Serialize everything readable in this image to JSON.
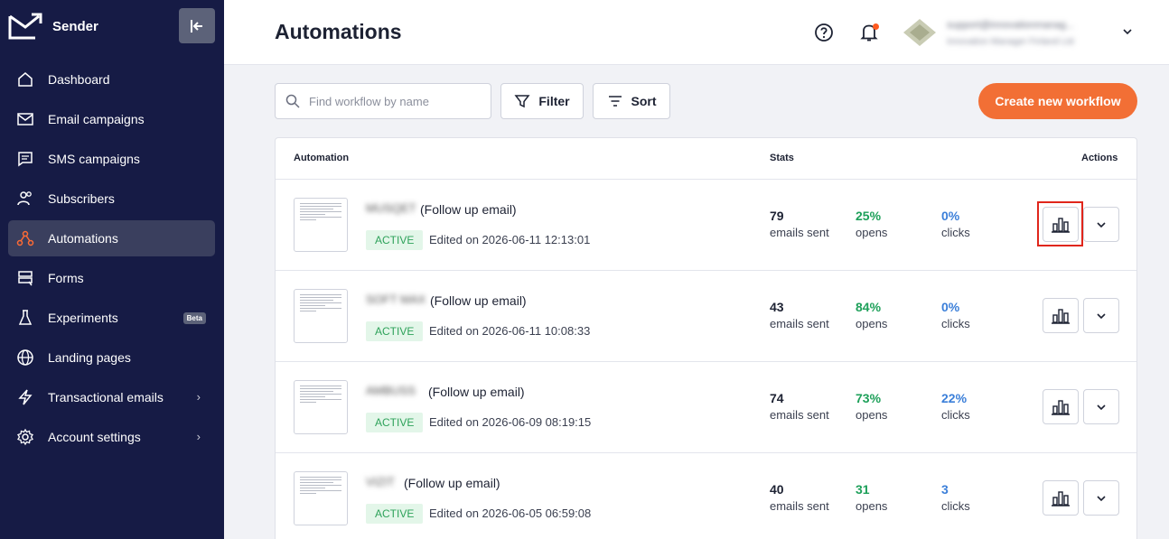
{
  "app": {
    "name": "Sender"
  },
  "sidebar": {
    "items": [
      {
        "label": "Dashboard",
        "icon": "home-icon"
      },
      {
        "label": "Email campaigns",
        "icon": "mail-icon"
      },
      {
        "label": "SMS campaigns",
        "icon": "chat-icon"
      },
      {
        "label": "Subscribers",
        "icon": "users-icon"
      },
      {
        "label": "Automations",
        "icon": "automation-icon",
        "active": true
      },
      {
        "label": "Forms",
        "icon": "form-icon"
      },
      {
        "label": "Experiments",
        "icon": "flask-icon",
        "badge": "Beta"
      },
      {
        "label": "Landing pages",
        "icon": "globe-icon"
      },
      {
        "label": "Transactional emails",
        "icon": "bolt-icon",
        "chevron": "›"
      },
      {
        "label": "Account settings",
        "icon": "gear-icon",
        "chevron": "›"
      }
    ]
  },
  "header": {
    "title": "Automations",
    "user_name": "support@innovationmanag...",
    "user_org": "Innovation Manager Finland Ltd"
  },
  "toolbar": {
    "search_placeholder": "Find workflow by name",
    "filter_label": "Filter",
    "sort_label": "Sort",
    "create_label": "Create new workflow"
  },
  "table": {
    "columns": {
      "automation": "Automation",
      "stats": "Stats",
      "actions": "Actions"
    },
    "stat_labels": {
      "sent": "emails sent",
      "opens": "opens",
      "clicks": "clicks"
    },
    "rows": [
      {
        "name_blur": "MUSQET",
        "name": "(Follow up email)",
        "status": "ACTIVE",
        "edited": "Edited on 2026-06-11 12:13:01",
        "sent": "79",
        "opens": "25%",
        "clicks": "0%"
      },
      {
        "name_blur": "SOFT MAX",
        "name": "(Follow up email)",
        "status": "ACTIVE",
        "edited": "Edited on 2026-06-11 10:08:33",
        "sent": "43",
        "opens": "84%",
        "clicks": "0%"
      },
      {
        "name_blur": "AMBUSS",
        "name": "(Follow up email)",
        "status": "ACTIVE",
        "edited": "Edited on 2026-06-09 08:19:15",
        "sent": "74",
        "opens": "73%",
        "clicks": "22%"
      },
      {
        "name_blur": "VIZIT",
        "name": "(Follow up email)",
        "status": "ACTIVE",
        "edited": "Edited on 2026-06-05 06:59:08",
        "sent": "40",
        "opens": "31",
        "clicks": "3"
      }
    ]
  },
  "colors": {
    "sidebar": "#161b45",
    "accent": "#f26f35",
    "opens": "#1ea05a",
    "clicks": "#3b7fd9",
    "highlight": "#e0261b"
  }
}
